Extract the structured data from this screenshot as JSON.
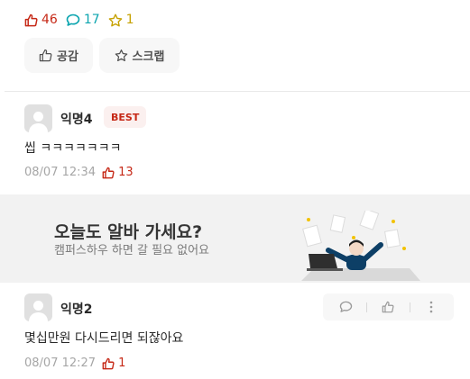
{
  "post": {
    "stats": {
      "likes": "46",
      "comments": "17",
      "scraps": "1"
    },
    "buttons": {
      "like_label": "공감",
      "scrap_label": "스크랩"
    }
  },
  "comments": [
    {
      "nickname": "익명4",
      "badge": "BEST",
      "text": "씹 ㅋㅋㅋㅋㅋㅋㅋ",
      "time": "08/07 12:34",
      "likes": "13"
    },
    {
      "nickname": "익명2",
      "text": "몇십만원 다시드리면 되잖아요",
      "time": "08/07 12:27",
      "likes": "1"
    }
  ],
  "banner": {
    "title": "오늘도 알바 가세요?",
    "subtitle": "캠퍼스하우 하면 갈 필요 없어요"
  },
  "colors": {
    "like": "#c62917",
    "comment": "#0ca5af",
    "scrap": "#c6a100",
    "banner_bg": "#f2f2f2",
    "person_shirt": "#0d3f66"
  }
}
